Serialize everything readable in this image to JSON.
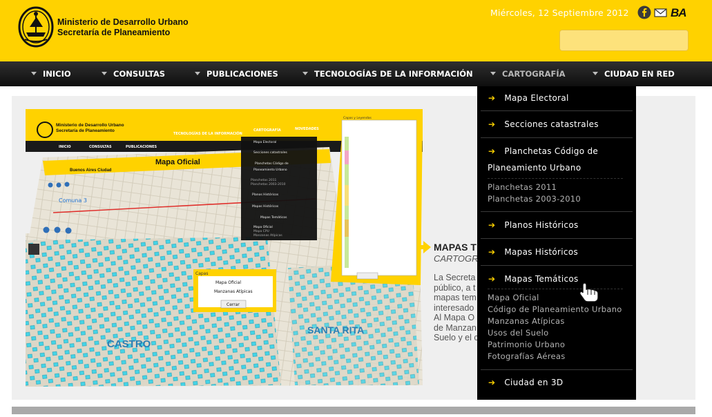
{
  "header": {
    "ministry_line1": "Ministerio de Desarrollo Urbano",
    "ministry_line2": "Secretaría de Planeamiento",
    "date": "Miércoles, 12 Septiembre 2012",
    "ba_logo_text": "BA",
    "search_value": ""
  },
  "nav": {
    "items": [
      {
        "label": "INICIO"
      },
      {
        "label": "CONSULTAS"
      },
      {
        "label": "PUBLICACIONES"
      },
      {
        "label": "TECNOLOGÍAS DE LA INFORMACIÓN"
      },
      {
        "label": "CARTOGRAFÍA"
      },
      {
        "label": "CIUDAD EN RED"
      }
    ]
  },
  "dropdown": {
    "items": [
      {
        "label": "Mapa Electoral"
      },
      {
        "label": "Secciones catastrales"
      },
      {
        "label": "Planchetas Código de",
        "label2": "Planeamiento Urbano",
        "subs": [
          "Planchetas 2011",
          "Planchetas 2003-2010"
        ]
      },
      {
        "label": "Planos Históricos"
      },
      {
        "label": "Mapas Históricos"
      },
      {
        "label": "Mapas Temáticos",
        "subs": [
          "Mapa Oficial",
          "Código de Planeamiento Urbano",
          "Manzanas Atípicas",
          "Usos del Suelo",
          "Patrimonio Urbano",
          "Fotografías Aéreas"
        ]
      },
      {
        "label": "Ciudad en 3D"
      }
    ]
  },
  "banner": {
    "site_title_1": "Ministerio de Desarrollo Urbano",
    "site_title_2": "Secretaría de Planeamiento",
    "mini_nav": [
      "INICIO",
      "CONSULTAS",
      "PUBLICACIONES",
      "TECNOLOGÍAS DE LA INFORMACIÓN",
      "CARTOGRAFÍA",
      "NOVEDADES"
    ],
    "mini_menu": [
      "Mapa Electoral",
      "Secciones catastrales",
      "Planchetas Código de",
      "Planeamiento Urbano",
      "Planchetas 2011",
      "Planchetas 2003-2010",
      "Planos Históricos",
      "Mapas Históricos",
      "Mapas Temáticos",
      "Mapa Oficial",
      "Mapa CPU",
      "Manzanas Atípicas"
    ],
    "city_label": "Buenos Aires Ciudad",
    "map_title": "Mapa Oficial",
    "comuna_label": "Comuna 3",
    "layers_title": "Capas y Leyendas",
    "layers_popup_title": "Capas",
    "layer_1": "Mapa Oficial",
    "layer_2": "Manzanas Atípicas",
    "close_button": "Cerrar",
    "place_1": "SANTA RITA",
    "place_2": "CASTRO"
  },
  "promo": {
    "title": "MAPAS T",
    "subtitle": "CARTOGR",
    "body": "La Secreta                              del\npúblico, a t                              de\nmapas tem                              os los\ninteresado\nAl Mapa O                              bano y al\nde Manzan                              Usos de\nSuelo y el c"
  },
  "colors": {
    "brand_yellow": "#ffd200",
    "nav_black": "#111111",
    "dropdown_black": "#000000",
    "map_cyan": "#3cd3e8"
  }
}
